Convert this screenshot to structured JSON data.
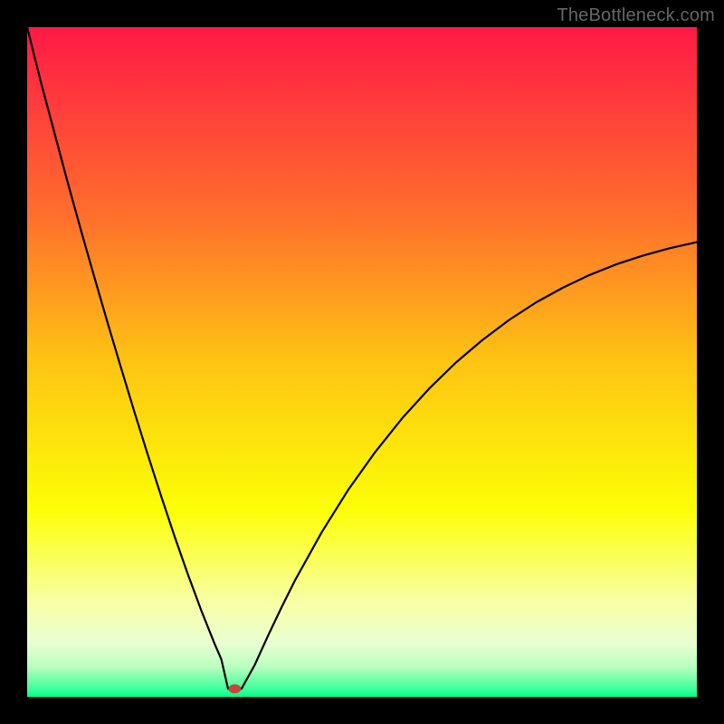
{
  "watermark": "TheBottleneck.com",
  "chart_data": {
    "type": "line",
    "title": "",
    "xlabel": "",
    "ylabel": "",
    "xlim": [
      0,
      100
    ],
    "ylim": [
      0,
      100
    ],
    "grid": false,
    "series": [
      {
        "name": "bottleneck-curve",
        "color": "#000000",
        "x": [
          0,
          2,
          4,
          6,
          8,
          10,
          12,
          14,
          16,
          18,
          20,
          22,
          24,
          26,
          28,
          29,
          30,
          31,
          32,
          34,
          36,
          38,
          40,
          44,
          48,
          52,
          56,
          60,
          64,
          68,
          72,
          76,
          80,
          84,
          88,
          92,
          96,
          100
        ],
        "y": [
          100,
          92,
          84.5,
          77,
          69.8,
          62.8,
          55.9,
          49.2,
          42.6,
          36.2,
          30,
          24,
          18.3,
          12.9,
          7.9,
          5.6,
          1.2,
          1.2,
          1.2,
          4.8,
          9.2,
          13.4,
          17.4,
          24.6,
          31.0,
          36.6,
          41.6,
          46.0,
          49.9,
          53.3,
          56.3,
          58.9,
          61.1,
          63.0,
          64.6,
          65.9,
          67.0,
          67.9
        ]
      }
    ],
    "annotations": [
      {
        "name": "vertex-marker",
        "x": 31,
        "y": 1.2,
        "shape": "ellipse",
        "color": "#c6453a"
      }
    ],
    "background_gradient": {
      "stops": [
        {
          "offset": 0.0,
          "color": "#ff1946"
        },
        {
          "offset": 0.28,
          "color": "#ff6e2c"
        },
        {
          "offset": 0.5,
          "color": "#fec413"
        },
        {
          "offset": 0.72,
          "color": "#fcff05"
        },
        {
          "offset": 0.86,
          "color": "#f8ffa6"
        },
        {
          "offset": 0.92,
          "color": "#e9ffd2"
        },
        {
          "offset": 0.955,
          "color": "#b9ffbf"
        },
        {
          "offset": 0.985,
          "color": "#4bff9e"
        },
        {
          "offset": 1.0,
          "color": "#00ff8e"
        }
      ]
    }
  }
}
